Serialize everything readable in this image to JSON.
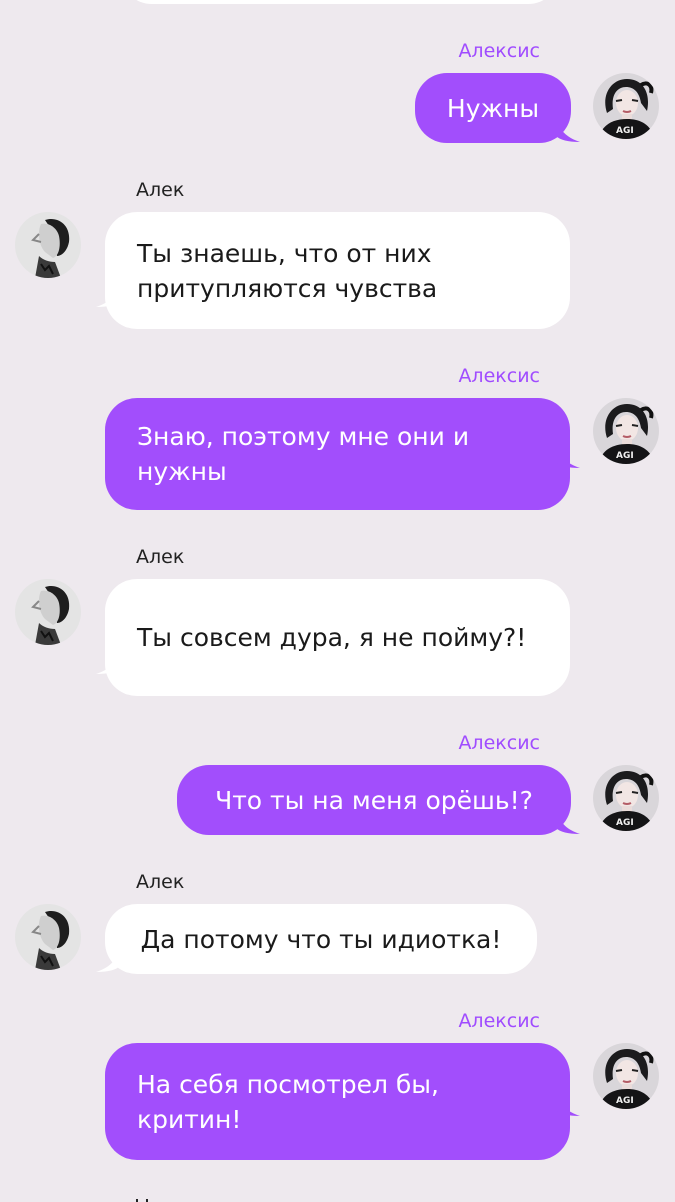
{
  "chat": {
    "messages": [
      {
        "sender": "Алексис",
        "side": "right",
        "text": "Нужны"
      },
      {
        "sender": "Алек",
        "side": "left",
        "text": "Ты знаешь, что от них притупляются чувства"
      },
      {
        "sender": "Алексис",
        "side": "right",
        "text": "Знаю, поэтому мне они и нужны"
      },
      {
        "sender": "Алек",
        "side": "left",
        "text": "Ты совсем дура, я не пойму?!"
      },
      {
        "sender": "Алексис",
        "side": "right",
        "text": "Что ты на меня орёшь!?"
      },
      {
        "sender": "Алек",
        "side": "left",
        "text": "Да потому что ты идиотка!"
      },
      {
        "sender": "Алексис",
        "side": "right",
        "text": "На себя посмотрел бы, критин!"
      }
    ]
  },
  "colors": {
    "background": "#eee9ee",
    "outgoing_bubble": "#a24efc",
    "incoming_bubble": "#ffffff",
    "outgoing_name": "#a04cff",
    "incoming_name": "#222222"
  }
}
